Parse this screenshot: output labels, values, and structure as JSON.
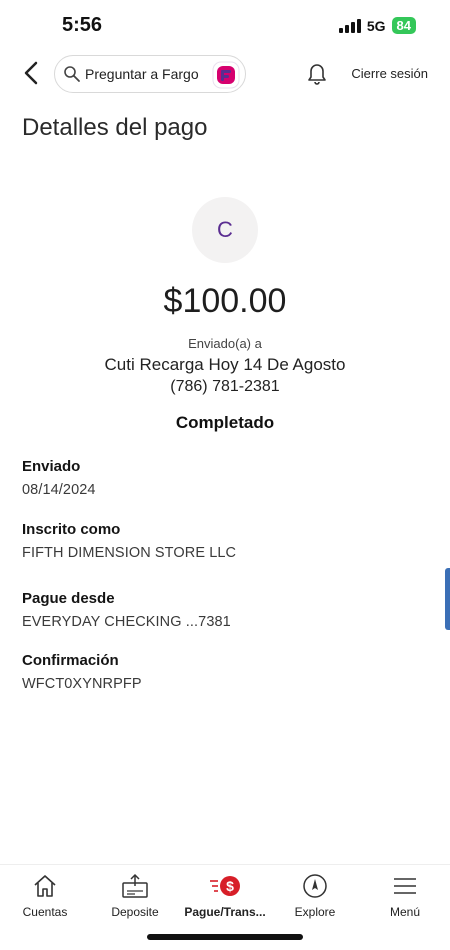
{
  "status_bar": {
    "time": "5:56",
    "network": "5G",
    "battery": "84"
  },
  "header": {
    "search_placeholder": "Preguntar a Fargo",
    "sign_out": "Cierre sesión"
  },
  "page": {
    "title": "Detalles del pago"
  },
  "payment": {
    "avatar_initial": "C",
    "amount": "$100.00",
    "sent_to_label": "Enviado(a) a",
    "recipient": "Cuti Recarga Hoy 14 De Agosto",
    "phone": "(786) 781-2381",
    "status": "Completado"
  },
  "details": [
    {
      "label": "Enviado",
      "value": "08/14/2024"
    },
    {
      "label": "Inscrito como",
      "value": "FIFTH DIMENSION STORE LLC"
    },
    {
      "label": "Pague desde",
      "value": "EVERYDAY CHECKING ...7381"
    },
    {
      "label": "Confirmación",
      "value": "WFCT0XYNRPFP"
    }
  ],
  "bottom_nav": [
    {
      "label": "Cuentas",
      "icon": "home-icon"
    },
    {
      "label": "Deposite",
      "icon": "deposit-icon"
    },
    {
      "label": "Pague/Trans...",
      "icon": "pay-transfer-icon",
      "active": true
    },
    {
      "label": "Explore",
      "icon": "compass-icon"
    },
    {
      "label": "Menú",
      "icon": "menu-icon"
    }
  ],
  "colors": {
    "brand_purple": "#5a2d91",
    "brand_pink": "#d6006f",
    "pay_red": "#d71e28",
    "battery_green": "#34c759"
  }
}
